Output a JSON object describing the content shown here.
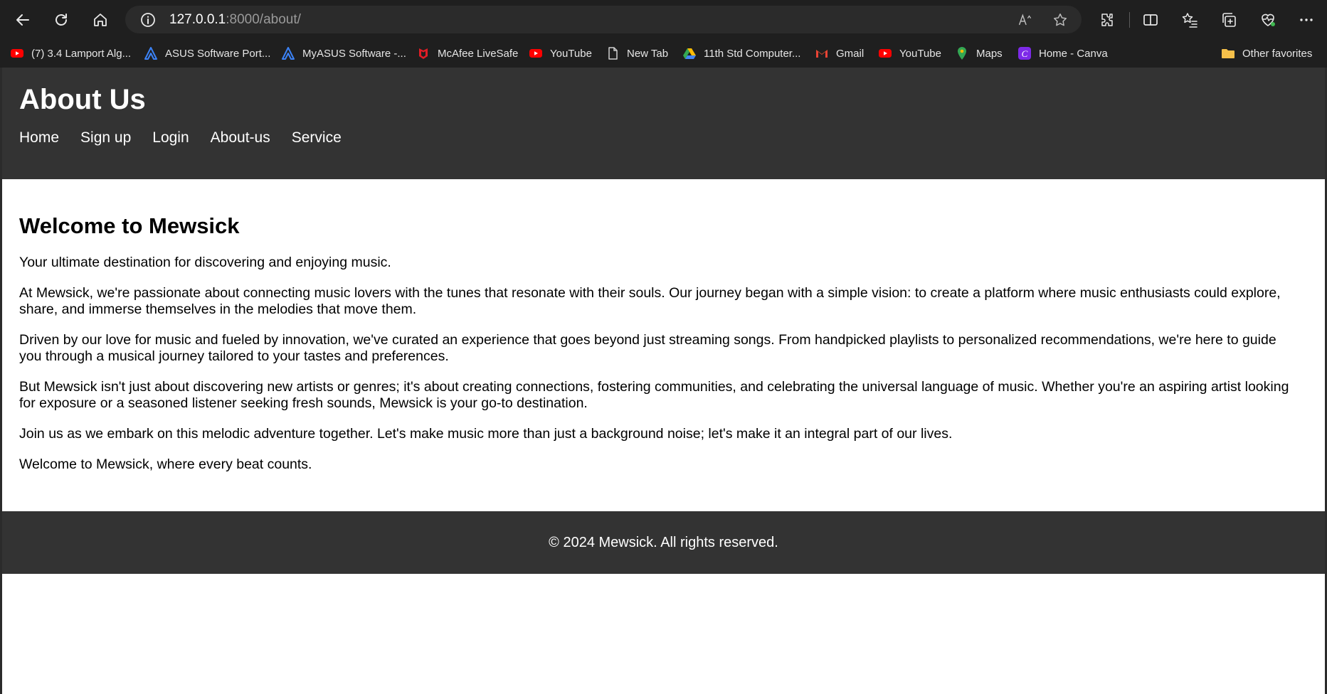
{
  "browser": {
    "url_host": "127.0.0.1",
    "url_rest": ":8000/about/",
    "bookmarks": [
      {
        "label": "(7) 3.4 Lamport Alg...",
        "icon": "youtube-icon",
        "color": "#ff0000"
      },
      {
        "label": "ASUS Software Port...",
        "icon": "asus-icon",
        "color": "#3b82f6"
      },
      {
        "label": "MyASUS Software -...",
        "icon": "asus-icon",
        "color": "#3b82f6"
      },
      {
        "label": "McAfee LiveSafe",
        "icon": "mcafee-icon",
        "color": "#e11d26"
      },
      {
        "label": "YouTube",
        "icon": "youtube-icon",
        "color": "#ff0000"
      },
      {
        "label": "New Tab",
        "icon": "page-icon",
        "color": "#cfcfcf"
      },
      {
        "label": "11th Std Computer...",
        "icon": "drive-icon",
        "color": "#34a853"
      },
      {
        "label": "Gmail",
        "icon": "gmail-icon",
        "color": "#ea4335"
      },
      {
        "label": "YouTube",
        "icon": "youtube-icon",
        "color": "#ff0000"
      },
      {
        "label": "Maps",
        "icon": "maps-icon",
        "color": "#34a853"
      },
      {
        "label": "Home - Canva",
        "icon": "canva-icon",
        "color": "#7d2ae8"
      }
    ],
    "other_favorites": "Other favorites"
  },
  "site": {
    "title": "About Us",
    "nav": [
      "Home",
      "Sign up",
      "Login",
      "About-us",
      "Service"
    ],
    "heading": "Welcome to Mewsick",
    "paragraphs": [
      "Your ultimate destination for discovering and enjoying music.",
      "At Mewsick, we're passionate about connecting music lovers with the tunes that resonate with their souls. Our journey began with a simple vision: to create a platform where music enthusiasts could explore, share, and immerse themselves in the melodies that move them.",
      "Driven by our love for music and fueled by innovation, we've curated an experience that goes beyond just streaming songs. From handpicked playlists to personalized recommendations, we're here to guide you through a musical journey tailored to your tastes and preferences.",
      "But Mewsick isn't just about discovering new artists or genres; it's about creating connections, fostering communities, and celebrating the universal language of music. Whether you're an aspiring artist looking for exposure or a seasoned listener seeking fresh sounds, Mewsick is your go-to destination.",
      "Join us as we embark on this melodic adventure together. Let's make music more than just a background noise; let's make it an integral part of our lives.",
      "Welcome to Mewsick, where every beat counts."
    ],
    "footer": "© 2024 Mewsick. All rights reserved."
  },
  "colors": {
    "chrome_bg": "#1f1f1f",
    "header_bg": "#333333",
    "page_bg": "#ffffff"
  }
}
